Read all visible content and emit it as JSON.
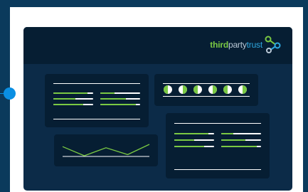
{
  "logo": {
    "part1": "third",
    "part2": "party",
    "part3": "trust",
    "colors": {
      "third": "#7ac943",
      "party": "#b9c8d6",
      "trust": "#2ea8e0"
    }
  },
  "colors": {
    "background": "#0b3a5c",
    "dashboard": "#0c2b48",
    "card": "#061e33",
    "accent_green": "#7ac943",
    "accent_blue": "#0a8fe3"
  },
  "widget_bars_left": {
    "levels": [
      0.85,
      0.55,
      0.75,
      0.35,
      0.65,
      0.9
    ]
  },
  "widget_bars_right": {
    "levels": [
      0.85,
      0.5,
      0.75,
      0.3,
      0.6,
      0.9
    ]
  },
  "widget_circles": {
    "fills": [
      0.5,
      0.5,
      0.5,
      0.5,
      0.5,
      0.5
    ]
  },
  "widget_line": {
    "values": [
      10,
      2,
      9,
      3,
      12
    ]
  }
}
